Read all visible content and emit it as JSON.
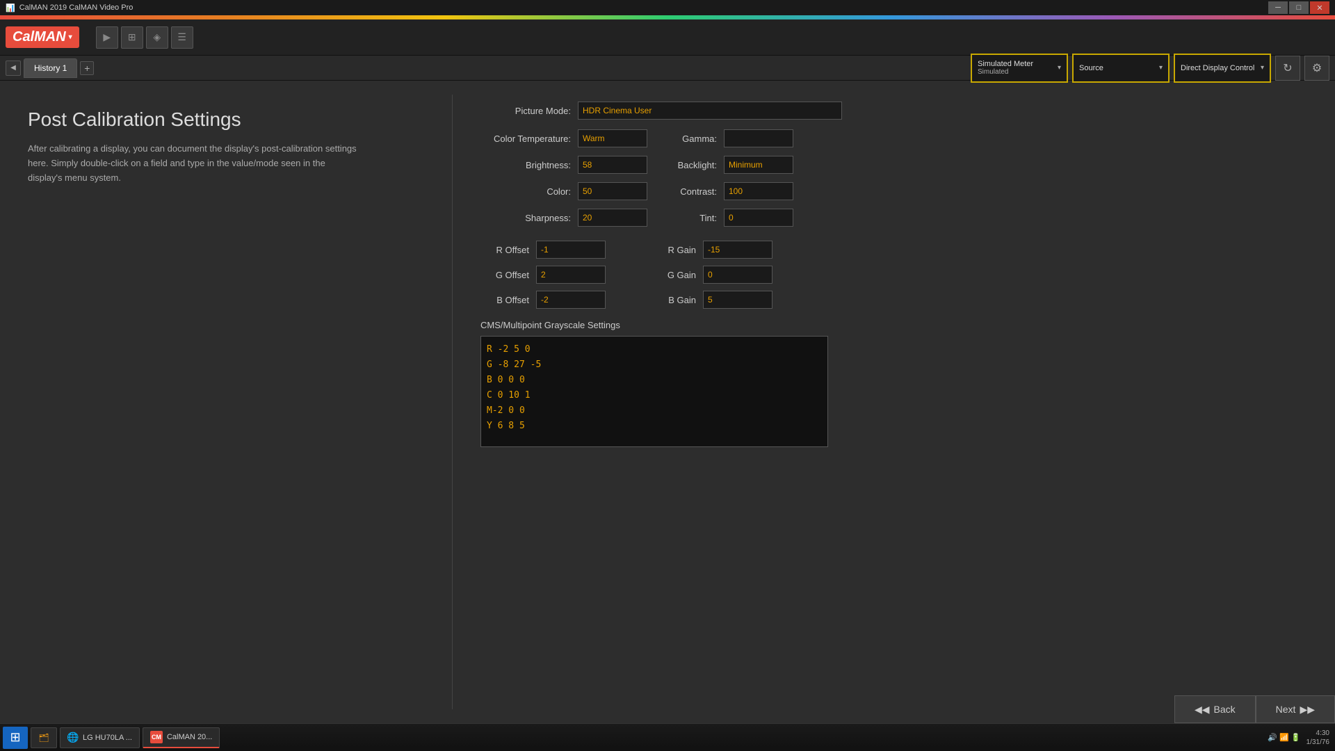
{
  "titleBar": {
    "title": "CalMAN 2019 CalMAN Video Pro",
    "icon": "C",
    "controls": [
      "─",
      "□",
      "✕"
    ]
  },
  "logo": {
    "text": "CalMAN",
    "arrow": "▾"
  },
  "tabBar": {
    "navBack": "◀",
    "navForward": "▶",
    "tabs": [
      {
        "label": "History 1",
        "active": true
      }
    ],
    "addTab": "+"
  },
  "topControls": {
    "meter": {
      "label": "Simulated Meter",
      "sub": "Simulated",
      "arrow": "▾"
    },
    "source": {
      "label": "Source",
      "arrow": "▾"
    },
    "display": {
      "label": "Direct Display Control",
      "arrow": "▾"
    },
    "settingsIcon": "⚙",
    "refreshIcon": "↻"
  },
  "page": {
    "title": "Post Calibration Settings",
    "description": "After calibrating a display, you can document the display's post-calibration settings here. Simply double-click on a field and type in the value/mode seen in the display's menu system."
  },
  "form": {
    "pictureModeLabel": "Picture Mode:",
    "pictureModeValue": "HDR Cinema User",
    "colorTempLabel": "Color Temperature:",
    "colorTempValue": "Warm",
    "gammaLabel": "Gamma:",
    "gammaValue": "",
    "brightnessLabel": "Brightness:",
    "brightnessValue": "58",
    "backlightLabel": "Backlight:",
    "backlightValue": "Minimum",
    "colorLabel": "Color:",
    "colorValue": "50",
    "contrastLabel": "Contrast:",
    "contrastValue": "100",
    "sharpnessLabel": "Sharpness:",
    "sharpnessValue": "20",
    "tintLabel": "Tint:",
    "tintValue": "0",
    "rOffsetLabel": "R Offset",
    "rOffsetValue": "-1",
    "rGainLabel": "R Gain",
    "rGainValue": "-15",
    "gOffsetLabel": "G Offset",
    "gOffsetValue": "2",
    "gGainLabel": "G Gain",
    "gGainValue": "0",
    "bOffsetLabel": "B Offset",
    "bOffsetValue": "-2",
    "bGainLabel": "B Gain",
    "bGainValue": "5",
    "cmsTitle": "CMS/Multipoint Grayscale Settings",
    "cmsValue": "R -2 5 0\nG -8 27 -5\nB 0 0 0\nC 0 10 1\nM-2 0 0\nY 6 8 5"
  },
  "navigation": {
    "backLabel": "Back",
    "backIcon": "◀◀",
    "nextLabel": "Next",
    "nextIcon": "▶▶"
  },
  "taskbar": {
    "startIcon": "⊞",
    "items": [
      {
        "icon": "🗂",
        "label": "",
        "color": "#f39c12"
      },
      {
        "icon": "🌐",
        "label": "LG HU70LA ...",
        "color": "#4CAF50"
      },
      {
        "icon": "CM",
        "label": "CalMAN 20...",
        "color": "#e74c3c"
      }
    ],
    "tray": {
      "time": "4:30",
      "date": "1/31/76"
    }
  },
  "toolbarIcons": [
    "▶",
    "⊞",
    "◈",
    "☰"
  ]
}
